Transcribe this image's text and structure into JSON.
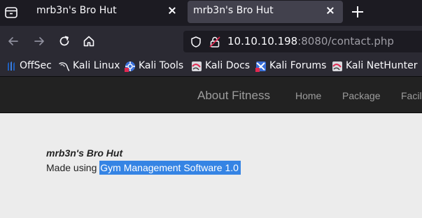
{
  "browser": {
    "tabs": [
      {
        "title": "mrb3n's Bro Hut",
        "active": false
      },
      {
        "title": "mrb3n's Bro Hut",
        "active": true
      }
    ],
    "url": {
      "host": "10.10.10.198",
      "rest": ":8080/contact.php"
    },
    "bookmarks": [
      {
        "label": "OffSec",
        "icon": "offsec-icon"
      },
      {
        "label": "Kali Linux",
        "icon": "kali-dragon-icon"
      },
      {
        "label": "Kali Tools",
        "icon": "kali-tools-icon"
      },
      {
        "label": "Kali Docs",
        "icon": "kali-docs-icon"
      },
      {
        "label": "Kali Forums",
        "icon": "kali-forums-icon"
      },
      {
        "label": "Kali NetHunter",
        "icon": "kali-nethunter-icon"
      }
    ]
  },
  "site": {
    "brand": "About Fitness",
    "nav": [
      "Home",
      "Package",
      "Facil"
    ],
    "name": "mrb3n's Bro Hut",
    "made_using_prefix": "Made using ",
    "software": "Gym Management Software 1.0"
  },
  "colors": {
    "tabbar_bg": "#1c1b22",
    "toolbar_bg": "#2b2a33",
    "header_bg": "#222222",
    "selection": "#3584e4"
  }
}
